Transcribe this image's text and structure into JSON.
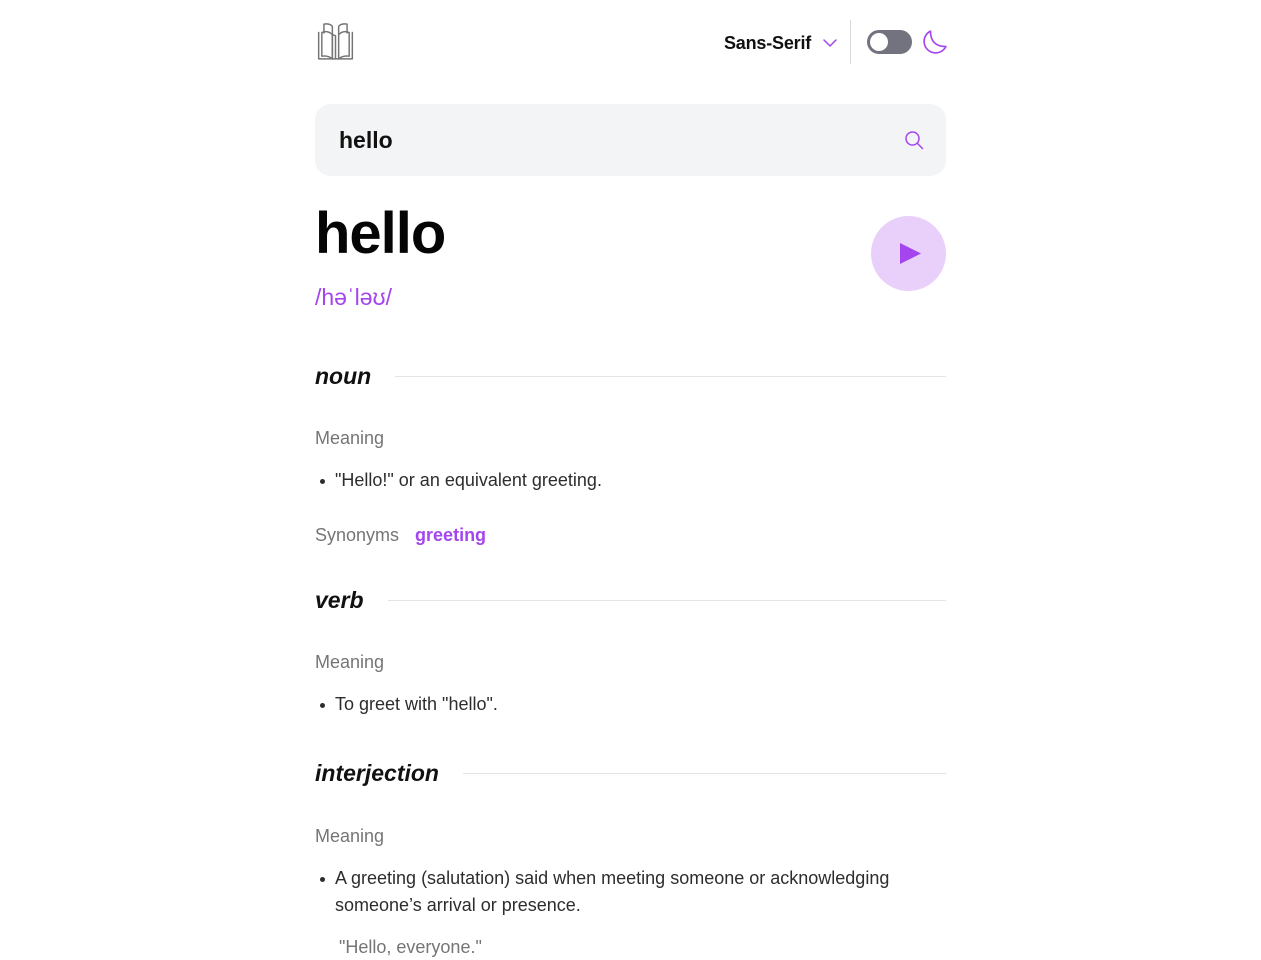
{
  "header": {
    "logo_icon": "book-icon",
    "font_selector": {
      "selected": "Sans-Serif",
      "icon": "chevron-down-icon"
    },
    "theme_toggle": {
      "state": "off"
    },
    "theme_icon": "moon-icon"
  },
  "search": {
    "value": "hello",
    "icon": "search-icon"
  },
  "entry": {
    "word": "hello",
    "phonetic": "/həˈləʊ/",
    "play_icon": "play-icon",
    "meanings": [
      {
        "part_of_speech": "noun",
        "meaning_label": "Meaning",
        "definitions": [
          "\"Hello!\" or an equivalent greeting."
        ],
        "synonyms_label": "Synonyms",
        "synonyms": [
          "greeting"
        ]
      },
      {
        "part_of_speech": "verb",
        "meaning_label": "Meaning",
        "definitions": [
          "To greet with \"hello\"."
        ]
      },
      {
        "part_of_speech": "interjection",
        "meaning_label": "Meaning",
        "definitions": [
          "A greeting (salutation) said when meeting someone or acknowledging someone’s arrival or presence."
        ],
        "examples": [
          "\"Hello, everyone.\""
        ]
      }
    ]
  },
  "colors": {
    "accent": "#a445ed",
    "play_bg": "#e9d0fa",
    "muted_text": "#757575",
    "search_bg": "#f3f4f5",
    "toggle_bg": "#737380"
  }
}
